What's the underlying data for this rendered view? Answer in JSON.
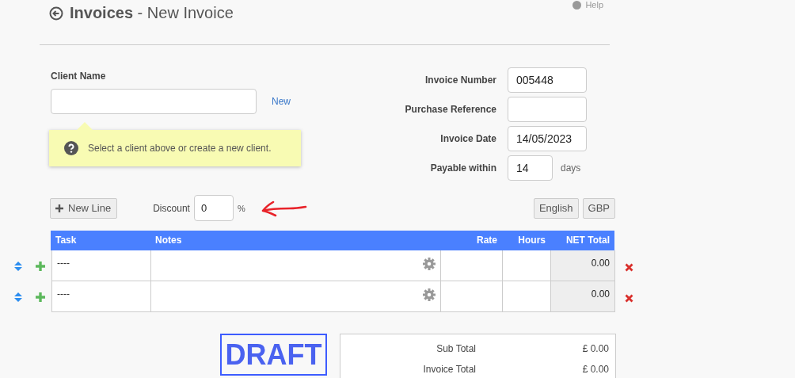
{
  "header": {
    "title": "**Invoices** - New Invoice",
    "help": "Help"
  },
  "client": {
    "label": "Client Name",
    "new_link": "New",
    "hint": "Select a client above or create a new client."
  },
  "invoice_fields": [
    {
      "label": "Invoice Number",
      "value": "005448"
    },
    {
      "label": "Purchase Reference"
    },
    {
      "label": "Invoice Date",
      "value": "14/05/2023"
    },
    {
      "label": "Payable within",
      "value": "14",
      "unit": "days"
    }
  ],
  "toolbar": {
    "new_line": "New Line",
    "discount_label": "Discount",
    "discount_value": "0",
    "discount_unit": "%",
    "language": "English",
    "currency": "GBP"
  },
  "table": {
    "columns": [
      "Task",
      "Notes",
      "Rate",
      "Hours",
      "NET Total"
    ],
    "rows": [
      {
        "task": "----",
        "net_total": "0.00"
      },
      {
        "task": "----",
        "net_total": "0.00"
      }
    ]
  },
  "status": "DRAFT",
  "totals": [
    {
      "label": "Sub Total",
      "value": "£ 0.00"
    },
    {
      "label": "Invoice Total",
      "value": "£ 0.00"
    }
  ]
}
